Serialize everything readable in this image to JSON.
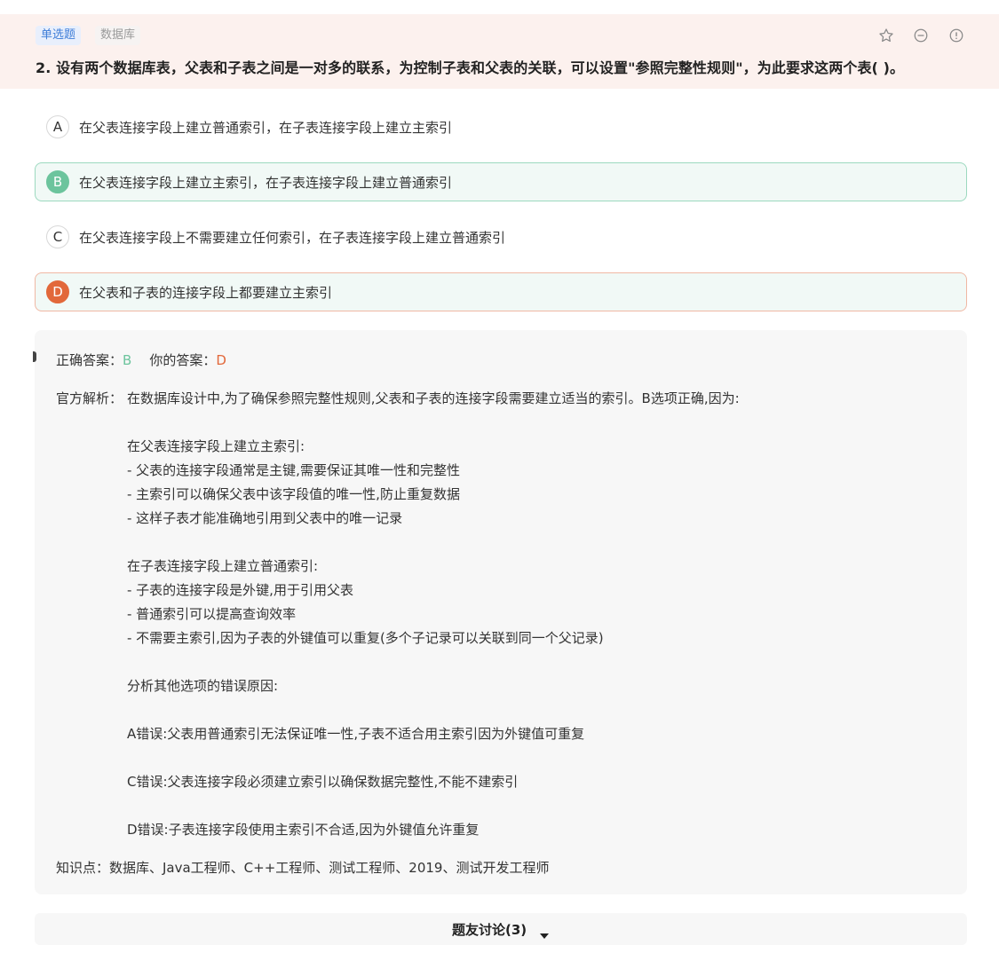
{
  "header": {
    "tag_type": "单选题",
    "tag_subject": "数据库",
    "icons": [
      "star-icon",
      "minus-circle-icon",
      "info-circle-icon"
    ],
    "question": "2. 设有两个数据库表，父表和子表之间是一对多的联系，为控制子表和父表的关联，可以设置\"参照完整性规则\"，为此要求这两个表(  )。"
  },
  "options": [
    {
      "letter": "A",
      "text": "在父表连接字段上建立普通索引，在子表连接字段上建立主索引",
      "state": "normal"
    },
    {
      "letter": "B",
      "text": "在父表连接字段上建立主索引，在子表连接字段上建立普通索引",
      "state": "correct"
    },
    {
      "letter": "C",
      "text": "在父表连接字段上不需要建立任何索引，在子表连接字段上建立普通索引",
      "state": "normal"
    },
    {
      "letter": "D",
      "text": "在父表和子表的连接字段上都要建立主索引",
      "state": "wrong"
    }
  ],
  "analysis": {
    "correct_label": "正确答案：",
    "correct_value": "B",
    "your_label": "你的答案：",
    "your_value": "D",
    "explanation_label": "官方解析：",
    "explanation_intro": "在数据库设计中,为了确保参照完整性规则,父表和子表的连接字段需要建立适当的索引。B选项正确,因为:",
    "lines": [
      "在父表连接字段上建立主索引:",
      "- 父表的连接字段通常是主键,需要保证其唯一性和完整性",
      "- 主索引可以确保父表中该字段值的唯一性,防止重复数据",
      "- 这样子表才能准确地引用到父表中的唯一记录",
      "在子表连接字段上建立普通索引:",
      "- 子表的连接字段是外键,用于引用父表",
      "- 普通索引可以提高查询效率",
      "- 不需要主索引,因为子表的外键值可以重复(多个子记录可以关联到同一个父记录)",
      "分析其他选项的错误原因:",
      "A错误:父表用普通索引无法保证唯一性,子表不适合用主索引因为外键值可重复",
      "C错误:父表连接字段必须建立索引以确保数据完整性,不能不建索引",
      "D错误:子表连接字段使用主索引不合适,因为外键值允许重复"
    ],
    "knowledge_points": "知识点：数据库、Java工程师、C++工程师、测试工程师、2019、测试开发工程师"
  },
  "discussion": {
    "label": "题友讨论(3)",
    "icon": "caret-down-icon"
  },
  "colors": {
    "correct": "#6cc49d",
    "wrong": "#e2683a",
    "header_bg": "#fcf1ee",
    "tag_type_text": "#3f7ed8"
  }
}
